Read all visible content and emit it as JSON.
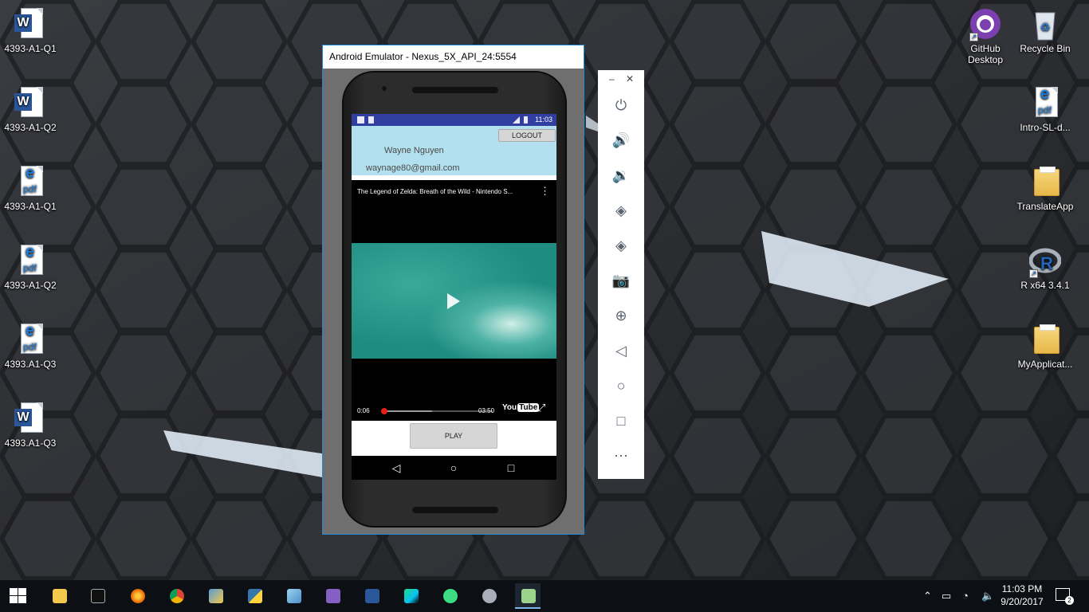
{
  "desktop": {
    "left_icons": [
      {
        "label": "4393-A1-Q1",
        "type": "word"
      },
      {
        "label": "4393-A1-Q2",
        "type": "word"
      },
      {
        "label": "4393-A1-Q1",
        "type": "pdf"
      },
      {
        "label": "4393-A1-Q2",
        "type": "pdf"
      },
      {
        "label": "4393.A1-Q3",
        "type": "pdf"
      },
      {
        "label": "4393.A1-Q3",
        "type": "word"
      }
    ],
    "right_icons": [
      {
        "label": "GitHub Desktop",
        "type": "github"
      },
      {
        "label": "Recycle Bin",
        "type": "recycle-bin"
      },
      {
        "label": "Intro-SL-d...",
        "type": "pdf"
      },
      {
        "label": "TranslateApp",
        "type": "folder"
      },
      {
        "label": "R x64 3.4.1",
        "type": "r-shortcut"
      },
      {
        "label": "MyApplicat...",
        "type": "folder"
      }
    ]
  },
  "emulator": {
    "title": "Android Emulator - Nexus_5X_API_24:5554",
    "status_time": "11:03",
    "app": {
      "logout_label": "LOGOUT",
      "user_name": "Wayne Nguyen",
      "user_email": "waynage80@gmail.com",
      "play_label": "PLAY"
    },
    "video": {
      "title": "The Legend of Zelda: Breath of the Wild - Nintendo S...",
      "current_time": "0:06",
      "total_time": "03:50",
      "played_fraction": 0.026,
      "buffered_fraction": 0.46,
      "logo_you": "You",
      "logo_tube": "Tube"
    },
    "nav_icons": [
      "back-icon",
      "home-icon",
      "recents-icon"
    ]
  },
  "emulator_toolbar": {
    "buttons": [
      "power-icon",
      "volume-up-icon",
      "volume-down-icon",
      "rotate-left-icon",
      "rotate-right-icon",
      "camera-icon",
      "zoom-icon",
      "back-icon",
      "home-icon",
      "overview-icon",
      "more-icon"
    ]
  },
  "taskbar": {
    "apps": [
      "start-icon",
      "file-explorer-icon",
      "command-prompt-icon",
      "firefox-icon",
      "chrome-icon",
      "tools-icon",
      "python-icon",
      "notepad-icon",
      "visual-studio-icon",
      "word-icon",
      "webstorm-icon",
      "android-studio-icon",
      "r-icon",
      "emulator-icon"
    ],
    "clock_time": "11:03 PM",
    "clock_date": "9/20/2017",
    "notification_count": "2"
  },
  "colors": {
    "status_bar": "#303f9f",
    "app_header": "#b3e0ee",
    "seek_played": "#e62117",
    "window_border": "#1f8ad6"
  }
}
